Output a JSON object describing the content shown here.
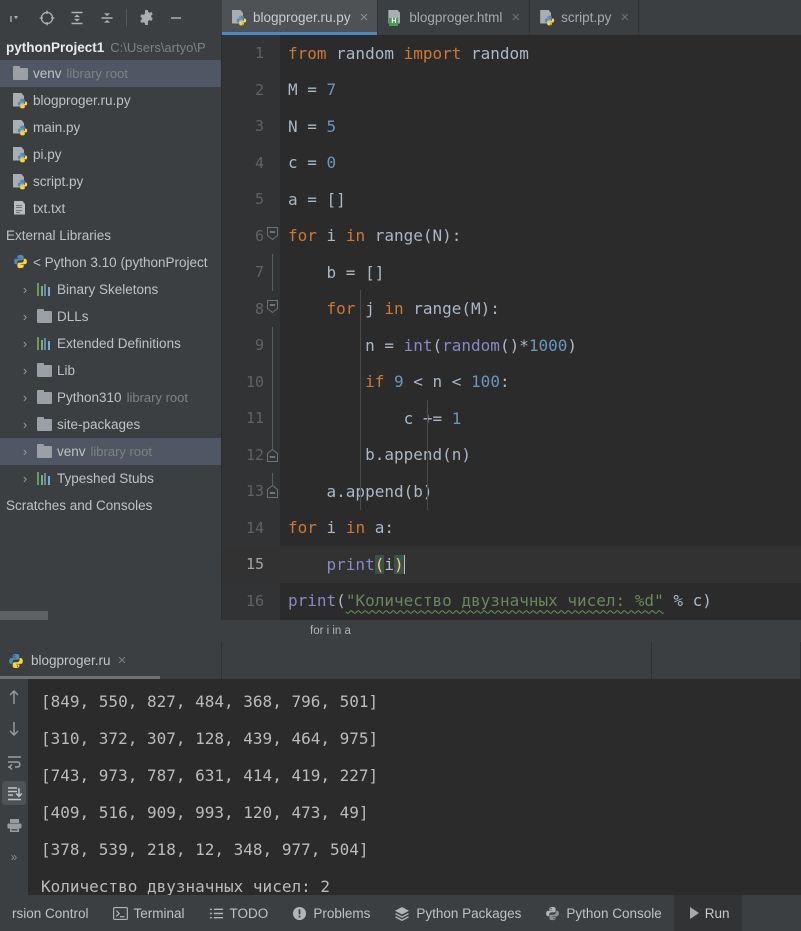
{
  "toolbar": {
    "buttons": [
      {
        "name": "project-view-dropdown",
        "icon": "caret-down-icon"
      },
      {
        "name": "select-opened-file",
        "icon": "target-icon"
      },
      {
        "name": "expand-all",
        "icon": "expand-all-icon"
      },
      {
        "name": "collapse-all",
        "icon": "collapse-all-icon"
      },
      {
        "name": "settings",
        "icon": "gear-icon"
      },
      {
        "name": "hide-panel",
        "icon": "minus-icon"
      }
    ]
  },
  "editor_tabs": [
    {
      "label": "blogproger.ru.py",
      "icon": "python-file-icon",
      "active": true,
      "close": "×"
    },
    {
      "label": "blogproger.html",
      "icon": "html-file-icon",
      "active": false,
      "close": "×"
    },
    {
      "label": "script.py",
      "icon": "python-file-icon",
      "active": false,
      "close": "×"
    }
  ],
  "project": {
    "name": "pythonProject1",
    "path": "C:\\Users\\artyo\\P",
    "tree": [
      {
        "label": "venv",
        "note": "library root",
        "icon": "folder-icon",
        "arrow": "",
        "depth": 0,
        "selected": true
      },
      {
        "label": "blogproger.ru.py",
        "note": "",
        "icon": "python-file-icon",
        "arrow": "",
        "depth": 0,
        "selected": false
      },
      {
        "label": "main.py",
        "note": "",
        "icon": "python-file-icon",
        "arrow": "",
        "depth": 0,
        "selected": false
      },
      {
        "label": "pi.py",
        "note": "",
        "icon": "python-file-icon",
        "arrow": "",
        "depth": 0,
        "selected": false
      },
      {
        "label": "script.py",
        "note": "",
        "icon": "python-file-icon",
        "arrow": "",
        "depth": 0,
        "selected": false
      },
      {
        "label": "txt.txt",
        "note": "",
        "icon": "text-file-icon",
        "arrow": "",
        "depth": 0,
        "selected": false
      },
      {
        "label": "External Libraries",
        "note": "",
        "icon": "none",
        "arrow": "",
        "depth": 0,
        "selected": false
      },
      {
        "label": "< Python 3.10 (pythonProject",
        "note": "",
        "icon": "python-logo-icon",
        "arrow": "",
        "depth": 0,
        "selected": false
      },
      {
        "label": "Binary Skeletons",
        "note": "",
        "icon": "bars-icon",
        "arrow": "›",
        "depth": 1,
        "selected": false
      },
      {
        "label": "DLLs",
        "note": "",
        "icon": "folder-icon",
        "arrow": "›",
        "depth": 1,
        "selected": false
      },
      {
        "label": "Extended Definitions",
        "note": "",
        "icon": "bars-icon",
        "arrow": "›",
        "depth": 1,
        "selected": false
      },
      {
        "label": "Lib",
        "note": "",
        "icon": "folder-icon",
        "arrow": "›",
        "depth": 1,
        "selected": false
      },
      {
        "label": "Python310",
        "note": "library root",
        "icon": "folder-icon",
        "arrow": "›",
        "depth": 1,
        "selected": false
      },
      {
        "label": "site-packages",
        "note": "",
        "icon": "folder-icon",
        "arrow": "›",
        "depth": 1,
        "selected": false
      },
      {
        "label": "venv",
        "note": "library root",
        "icon": "folder-icon",
        "arrow": "›",
        "depth": 1,
        "selected": true
      },
      {
        "label": "Typeshed Stubs",
        "note": "",
        "icon": "bars-icon",
        "arrow": "›",
        "depth": 1,
        "selected": false
      },
      {
        "label": "Scratches and Consoles",
        "note": "",
        "icon": "none",
        "arrow": "",
        "depth": 0,
        "selected": false
      }
    ]
  },
  "code": {
    "lines": [
      {
        "num": "1",
        "fold": "none",
        "current": false
      },
      {
        "num": "2",
        "fold": "none",
        "current": false
      },
      {
        "num": "3",
        "fold": "none",
        "current": false
      },
      {
        "num": "4",
        "fold": "none",
        "current": false
      },
      {
        "num": "5",
        "fold": "none",
        "current": false
      },
      {
        "num": "6",
        "fold": "open-down",
        "current": false
      },
      {
        "num": "7",
        "fold": "bar",
        "current": false
      },
      {
        "num": "8",
        "fold": "open-down",
        "current": false
      },
      {
        "num": "9",
        "fold": "bar",
        "current": false
      },
      {
        "num": "10",
        "fold": "bar",
        "current": false
      },
      {
        "num": "11",
        "fold": "bar",
        "current": false
      },
      {
        "num": "12",
        "fold": "open-up",
        "current": false
      },
      {
        "num": "13",
        "fold": "open-up",
        "current": false
      },
      {
        "num": "14",
        "fold": "none",
        "current": false
      },
      {
        "num": "15",
        "fold": "none",
        "current": true
      },
      {
        "num": "16",
        "fold": "none",
        "current": false
      }
    ],
    "text": [
      "from random import random",
      "M = 7",
      "N = 5",
      "c = 0",
      "a = []",
      "for i in range(N):",
      "    b = []",
      "    for j in range(M):",
      "        n = int(random()*1000)",
      "        if 9 < n < 100:",
      "            c += 1",
      "        b.append(n)",
      "    a.append(b)",
      "for i in a:",
      "    print(i)",
      "print(\"Количество двузначных чисел: %d\" % c)"
    ],
    "tokens": {
      "l1_kw_from": "from",
      "l1_mod": " random ",
      "l1_kw_import": "import",
      "l1_mod2": " random",
      "l2_a": "M = ",
      "l2_n": "7",
      "l3_a": "N = ",
      "l3_n": "5",
      "l4_a": "c = ",
      "l4_n": "0",
      "l5_a": "a = []",
      "l6_for": "for",
      "l6_i": " i ",
      "l6_in": "in",
      "l6_rest": " range(N):",
      "l7_a": "    b = []",
      "l8_pad": "    ",
      "l8_for": "for",
      "l8_j": " j ",
      "l8_in": "in",
      "l8_rest": " range(M):",
      "l9_pad": "        n = ",
      "l9_fn": "int",
      "l9_p1": "(",
      "l9_fn2": "random",
      "l9_p2": "()*",
      "l9_n": "1000",
      "l9_p3": ")",
      "l10_pad": "        ",
      "l10_if": "if",
      "l10_s1": " ",
      "l10_n1": "9",
      "l10_s2": " < n < ",
      "l10_n2": "100",
      "l10_s3": ":",
      "l11_pad": "            c += ",
      "l11_n": "1",
      "l12_a": "        b.append(n)",
      "l13_a": "    a.append(b)",
      "l14_for": "for",
      "l14_i": " i ",
      "l14_in": "in",
      "l14_rest": " a:",
      "l15_pad": "    ",
      "l15_fn": "print",
      "l15_b1": "(",
      "l15_i": "i",
      "l15_b2": ")",
      "l16_fn": "print",
      "l16_p": "(",
      "l16_str": "\"Количество двузначных чисел: %d\"",
      "l16_rest": " % c)"
    }
  },
  "breadcrumb": {
    "text": "for i in a"
  },
  "run": {
    "tab_label": "blogproger.ru",
    "tab_close": "×",
    "tab_icon": "python-logo-icon",
    "gutter": [
      {
        "name": "rerun-up-icon",
        "glyph": "↑",
        "active": false
      },
      {
        "name": "step-down-icon",
        "glyph": "↓",
        "active": false
      },
      {
        "name": "soft-wrap-icon",
        "glyph": "wrap",
        "active": false
      },
      {
        "name": "scroll-to-end-icon",
        "glyph": "scroll",
        "active": true
      },
      {
        "name": "print-icon",
        "glyph": "print",
        "active": false
      },
      {
        "name": "more-options-icon",
        "glyph": "»",
        "active": false
      }
    ],
    "console_lines": [
      "[849, 550, 827, 484, 368, 796, 501]",
      "[310, 372, 307, 128, 439, 464, 975]",
      "[743, 973, 787, 631, 414, 419, 227]",
      "[409, 516, 909, 993, 120, 473, 49]",
      "[378, 539, 218, 12, 348, 977, 504]",
      "Количество двузначных чисел: 2"
    ]
  },
  "statusbar": {
    "items": [
      {
        "label": "rsion Control",
        "icon": "none"
      },
      {
        "label": "Terminal",
        "icon": "terminal-icon"
      },
      {
        "label": "TODO",
        "icon": "list-icon"
      },
      {
        "label": "Problems",
        "icon": "warning-icon"
      },
      {
        "label": "Python Packages",
        "icon": "layers-icon"
      },
      {
        "label": "Python Console",
        "icon": "python-logo-icon"
      },
      {
        "label": "Run",
        "icon": "play-icon"
      }
    ]
  },
  "colors": {
    "bg_panel": "#3c3f41",
    "bg_editor": "#2b2b2b",
    "selection": "#4e5763",
    "tab_active": "#4e5254",
    "tab_underline": "#4a88c7",
    "keyword": "#cc7832",
    "number": "#6897bb",
    "function": "#8888c6",
    "string": "#6a8759",
    "default_text": "#a9b7c6",
    "brace_match_fg": "#ffc66d",
    "brace_match_bg": "#3b514d"
  }
}
